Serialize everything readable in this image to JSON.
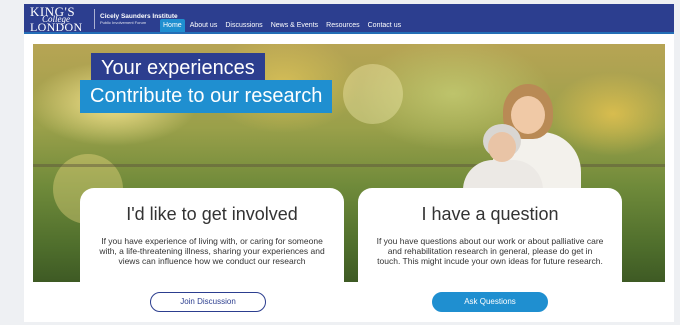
{
  "brand": {
    "logo_line1": "KING'S",
    "logo_line2": "College",
    "logo_line3": "LONDON",
    "institute_name": "Cicely Saunders Institute",
    "institute_sub": "Public Involvement Forum"
  },
  "nav": {
    "items": [
      "Home",
      "About us",
      "Discussions",
      "News & Events",
      "Resources",
      "Contact us"
    ],
    "active_index": 0
  },
  "hero": {
    "headline_line1": "Your experiences",
    "headline_line2": "Contribute to our research"
  },
  "cards": {
    "involved": {
      "title": "I'd like to get involved",
      "body": "If you have experience of living with, or caring for someone with, a life-threatening illness, sharing your experiences and views can influence how we conduct our research",
      "button": "Join Discussion"
    },
    "question": {
      "title": "I have a question",
      "body": "If you have questions about our work or about palliative care and rehabilitation research in general, please do get in touch. This might incude your own ideas for future research.",
      "button": "Ask Questions"
    }
  },
  "colors": {
    "navy": "#2c3e8f",
    "accent_blue": "#1f8fd0"
  }
}
